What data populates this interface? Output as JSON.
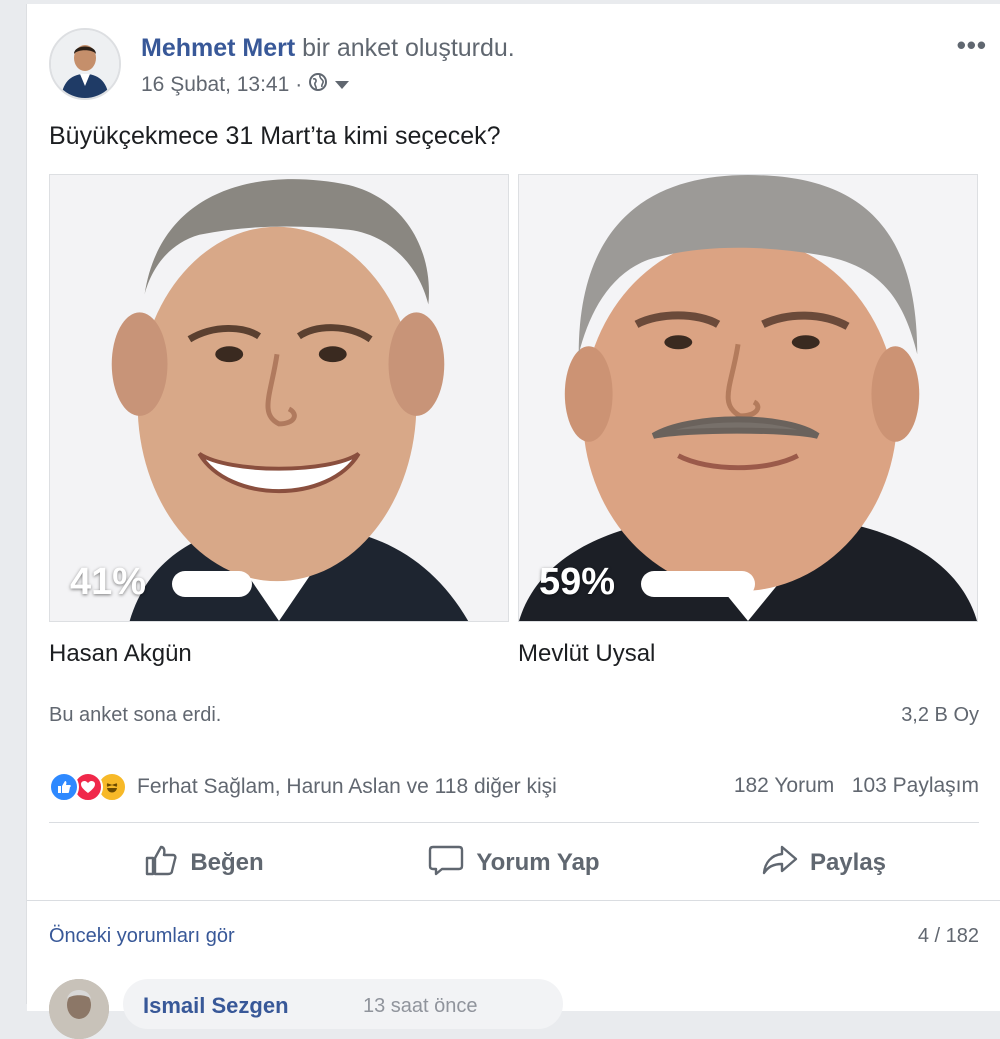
{
  "post": {
    "author_name": "Mehmet Mert",
    "author_action": " bir anket oluşturdu.",
    "timestamp": "16 Şubat, 13:41",
    "separator": "·",
    "privacy_icon": "globe-icon",
    "question": "Büyükçekmece 31 Mart’ta kimi seçecek?"
  },
  "poll": {
    "options": [
      {
        "name": "Hasan Akgün",
        "percent_label": "41%",
        "percent": 41
      },
      {
        "name": "Mevlüt Uysal",
        "percent_label": "59%",
        "percent": 59
      }
    ],
    "status": "Bu anket sona erdi.",
    "votes": "3,2 B Oy"
  },
  "reactions": {
    "icons": [
      "like-icon",
      "love-icon",
      "haha-icon"
    ],
    "names": "Ferhat Sağlam, Harun Aslan ve 118 diğer kişi",
    "comments": "182 Yorum",
    "shares": "103 Paylaşım"
  },
  "actions": {
    "like": "Beğen",
    "comment": "Yorum Yap",
    "share": "Paylaş"
  },
  "comments": {
    "previous_link": "Önceki yorumları gör",
    "count": "4 / 182",
    "first_author": "Ismail Sezgen",
    "first_time": "13 saat önce"
  },
  "colors": {
    "link": "#385898",
    "secondary_text": "#606770",
    "like_blue": "#2e89ff",
    "love_red": "#f0284a",
    "haha_yellow": "#f7b928"
  }
}
